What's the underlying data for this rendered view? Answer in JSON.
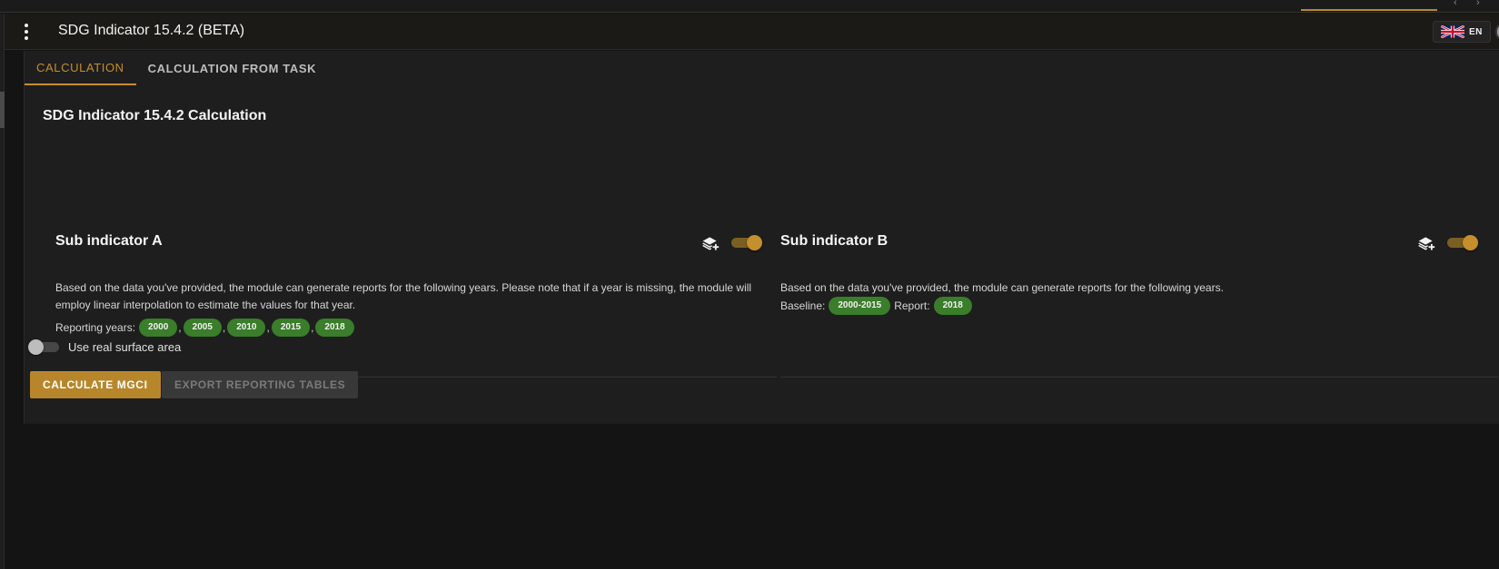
{
  "app": {
    "title": "SDG Indicator 15.4.2 (BETA)",
    "language": "EN"
  },
  "tabs": [
    {
      "label": "CALCULATION",
      "active": true
    },
    {
      "label": "CALCULATION FROM TASK",
      "active": false
    }
  ],
  "page_title": "SDG Indicator 15.4.2 Calculation",
  "sub_indicator_a": {
    "title": "Sub indicator A",
    "enabled": true,
    "description": "Based on the data you've provided, the module can generate reports for the following years. Please note that if a year is missing, the module will employ linear interpolation to estimate the values for that year.",
    "years_label": "Reporting years:",
    "years": [
      "2000",
      "2005",
      "2010",
      "2015",
      "2018"
    ]
  },
  "sub_indicator_b": {
    "title": "Sub indicator B",
    "enabled": true,
    "description": "Based on the data you've provided, the module can generate reports for the following years.",
    "baseline_label": "Baseline:",
    "baseline": "2000-2015",
    "report_label": "Report:",
    "report": "2018"
  },
  "options": {
    "real_surface_label": "Use real surface area",
    "real_surface_enabled": false
  },
  "actions": {
    "calculate_label": "CALCULATE MGCI",
    "export_label": "EXPORT REPORTING TABLES",
    "export_enabled": false
  },
  "icons": {
    "menu": "more-vert-icon",
    "flag": "uk-flag-icon",
    "layer": "add-layer-icon"
  },
  "colors": {
    "accent": "#c48f2c",
    "chip": "#3a7d2a",
    "background": "#1e1e1e"
  }
}
